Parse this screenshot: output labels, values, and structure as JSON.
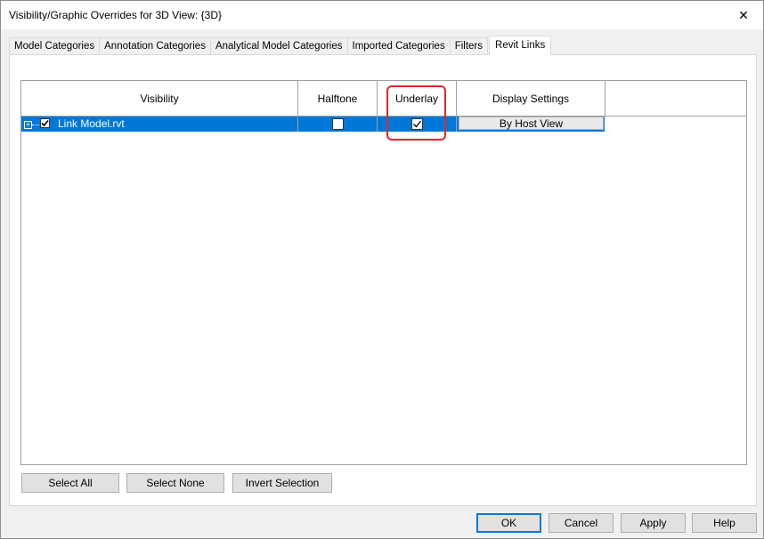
{
  "window": {
    "title": "Visibility/Graphic Overrides for 3D View: {3D}",
    "close_glyph": "✕"
  },
  "tabs": [
    {
      "label": "Model Categories"
    },
    {
      "label": "Annotation Categories"
    },
    {
      "label": "Analytical Model Categories"
    },
    {
      "label": "Imported Categories"
    },
    {
      "label": "Filters"
    },
    {
      "label": "Revit Links",
      "active": true
    }
  ],
  "grid": {
    "columns": [
      "Visibility",
      "Halftone",
      "Underlay",
      "Display Settings"
    ],
    "rows": [
      {
        "expander": "+",
        "visible_checked": true,
        "name": "Link Model.rvt",
        "halftone": false,
        "underlay": true,
        "display_settings": "By Host View"
      }
    ]
  },
  "selection_buttons": {
    "select_all": "Select All",
    "select_none": "Select None",
    "invert_selection": "Invert Selection"
  },
  "dialog_buttons": {
    "ok": "OK",
    "cancel": "Cancel",
    "apply": "Apply",
    "help": "Help"
  },
  "colors": {
    "selection": "#0078d7",
    "highlight": "#e0272d"
  }
}
